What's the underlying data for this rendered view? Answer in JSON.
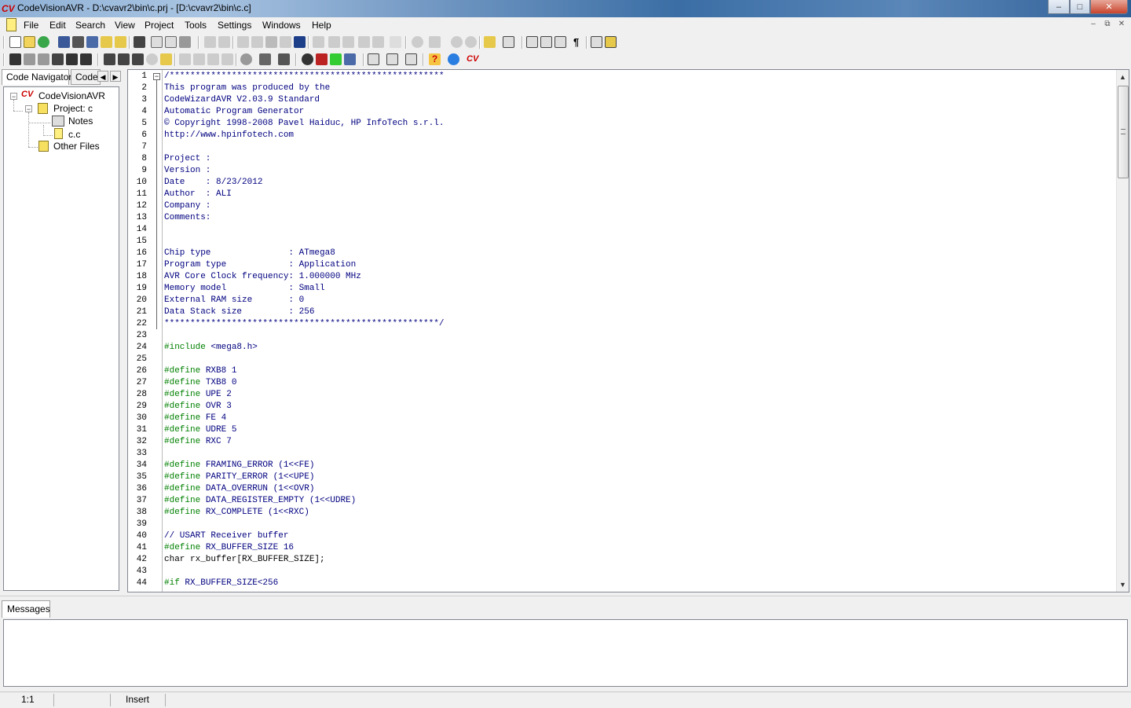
{
  "window": {
    "title": "CodeVisionAVR - D:\\cvavr2\\bin\\c.prj - [D:\\cvavr2\\bin\\c.c]",
    "logo_text": "CV",
    "minimize": "–",
    "maximize": "□",
    "close": "✕"
  },
  "menu": {
    "items": [
      "File",
      "Edit",
      "Search",
      "View",
      "Project",
      "Tools",
      "Settings",
      "Windows",
      "Help"
    ]
  },
  "navigator": {
    "tabs": [
      "Code Navigator",
      "Code"
    ],
    "tree": {
      "root": "CodeVisionAVR",
      "project": "Project: c",
      "notes": "Notes",
      "file": "c.c",
      "other": "Other Files"
    }
  },
  "editor": {
    "lines": [
      {
        "n": "1",
        "t": "/*****************************************************",
        "k": ""
      },
      {
        "n": "2",
        "t": "This program was produced by the",
        "k": ""
      },
      {
        "n": "3",
        "t": "CodeWizardAVR V2.03.9 Standard",
        "k": ""
      },
      {
        "n": "4",
        "t": "Automatic Program Generator",
        "k": ""
      },
      {
        "n": "5",
        "t": "© Copyright 1998-2008 Pavel Haiduc, HP InfoTech s.r.l.",
        "k": ""
      },
      {
        "n": "6",
        "t": "http://www.hpinfotech.com",
        "k": ""
      },
      {
        "n": "7",
        "t": "",
        "k": ""
      },
      {
        "n": "8",
        "t": "Project :",
        "k": ""
      },
      {
        "n": "9",
        "t": "Version :",
        "k": ""
      },
      {
        "n": "10",
        "t": "Date    : 8/23/2012",
        "k": ""
      },
      {
        "n": "11",
        "t": "Author  : ALI",
        "k": ""
      },
      {
        "n": "12",
        "t": "Company :",
        "k": ""
      },
      {
        "n": "13",
        "t": "Comments:",
        "k": ""
      },
      {
        "n": "14",
        "t": "",
        "k": ""
      },
      {
        "n": "15",
        "t": "",
        "k": ""
      },
      {
        "n": "16",
        "t": "Chip type               : ATmega8",
        "k": ""
      },
      {
        "n": "17",
        "t": "Program type            : Application",
        "k": ""
      },
      {
        "n": "18",
        "t": "AVR Core Clock frequency: 1.000000 MHz",
        "k": ""
      },
      {
        "n": "19",
        "t": "Memory model            : Small",
        "k": ""
      },
      {
        "n": "20",
        "t": "External RAM size       : 0",
        "k": ""
      },
      {
        "n": "21",
        "t": "Data Stack size         : 256",
        "k": ""
      },
      {
        "n": "22",
        "t": "*****************************************************/",
        "k": ""
      },
      {
        "n": "23",
        "t": "",
        "k": ""
      },
      {
        "n": "24",
        "t": " <mega8.h>",
        "k": "#include"
      },
      {
        "n": "25",
        "t": "",
        "k": ""
      },
      {
        "n": "26",
        "t": " RXB8 1",
        "k": "#define"
      },
      {
        "n": "27",
        "t": " TXB8 0",
        "k": "#define"
      },
      {
        "n": "28",
        "t": " UPE 2",
        "k": "#define"
      },
      {
        "n": "29",
        "t": " OVR 3",
        "k": "#define"
      },
      {
        "n": "30",
        "t": " FE 4",
        "k": "#define"
      },
      {
        "n": "31",
        "t": " UDRE 5",
        "k": "#define"
      },
      {
        "n": "32",
        "t": " RXC 7",
        "k": "#define"
      },
      {
        "n": "33",
        "t": "",
        "k": ""
      },
      {
        "n": "34",
        "t": " FRAMING_ERROR (1<<FE)",
        "k": "#define"
      },
      {
        "n": "35",
        "t": " PARITY_ERROR (1<<UPE)",
        "k": "#define"
      },
      {
        "n": "36",
        "t": " DATA_OVERRUN (1<<OVR)",
        "k": "#define"
      },
      {
        "n": "37",
        "t": " DATA_REGISTER_EMPTY (1<<UDRE)",
        "k": "#define"
      },
      {
        "n": "38",
        "t": " RX_COMPLETE (1<<RXC)",
        "k": "#define"
      },
      {
        "n": "39",
        "t": "",
        "k": ""
      },
      {
        "n": "40",
        "t": "// USART Receiver buffer",
        "k": ""
      },
      {
        "n": "41",
        "t": " RX_BUFFER_SIZE 16",
        "k": "#define"
      },
      {
        "n": "42",
        "t": "char rx_buffer[RX_BUFFER_SIZE];",
        "k": "",
        "plain": true
      },
      {
        "n": "43",
        "t": "",
        "k": ""
      },
      {
        "n": "44",
        "t": " RX_BUFFER_SIZE<256",
        "k": "#if"
      }
    ]
  },
  "messages": {
    "tab": "Messages"
  },
  "status": {
    "position": "1:1",
    "mode": "Insert"
  },
  "colors": {
    "code_text": "#000080",
    "keyword": "#008000"
  }
}
